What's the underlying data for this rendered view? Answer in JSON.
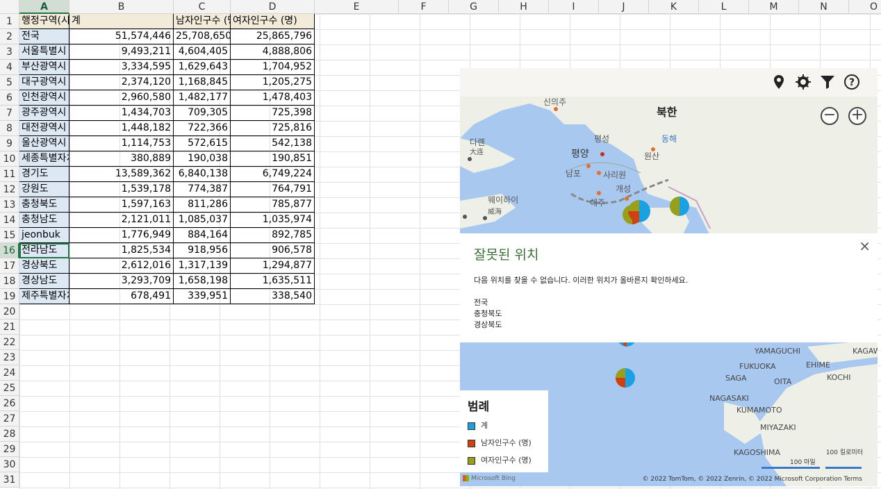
{
  "columns": [
    "A",
    "B",
    "C",
    "D",
    "E",
    "F",
    "G",
    "H",
    "I",
    "J",
    "K",
    "L",
    "M",
    "N",
    "O"
  ],
  "rows": [
    "1",
    "2",
    "3",
    "4",
    "5",
    "6",
    "7",
    "8",
    "9",
    "10",
    "11",
    "12",
    "13",
    "14",
    "15",
    "16",
    "17",
    "18",
    "19",
    "20",
    "21",
    "22",
    "23",
    "24",
    "25",
    "26",
    "27",
    "28",
    "29",
    "30",
    "31"
  ],
  "table": {
    "headers": [
      "행정구역(시군구)별",
      "계",
      "남자인구수 (명)",
      "여자인구수 (명)"
    ],
    "rows": [
      [
        "전국",
        "51,574,446",
        "25,708,650",
        "25,865,796"
      ],
      [
        "서울특별시",
        "9,493,211",
        "4,604,405",
        "4,888,806"
      ],
      [
        "부산광역시",
        "3,334,595",
        "1,629,643",
        "1,704,952"
      ],
      [
        "대구광역시",
        "2,374,120",
        "1,168,845",
        "1,205,275"
      ],
      [
        "인천광역시",
        "2,960,580",
        "1,482,177",
        "1,478,403"
      ],
      [
        "광주광역시",
        "1,434,703",
        "709,305",
        "725,398"
      ],
      [
        "대전광역시",
        "1,448,182",
        "722,366",
        "725,816"
      ],
      [
        "울산광역시",
        "1,114,753",
        "572,615",
        "542,138"
      ],
      [
        "세종특별자치시",
        "380,889",
        "190,038",
        "190,851"
      ],
      [
        "경기도",
        "13,589,362",
        "6,840,138",
        "6,749,224"
      ],
      [
        "강원도",
        "1,539,178",
        "774,387",
        "764,791"
      ],
      [
        "충청북도",
        "1,597,163",
        "811,286",
        "785,877"
      ],
      [
        "충청남도",
        "2,121,011",
        "1,085,037",
        "1,035,974"
      ],
      [
        "jeonbuk",
        "1,776,949",
        "884,164",
        "892,785"
      ],
      [
        "전라남도",
        "1,825,534",
        "918,956",
        "906,578"
      ],
      [
        "경상북도",
        "2,612,016",
        "1,317,139",
        "1,294,877"
      ],
      [
        "경상남도",
        "3,293,709",
        "1,658,198",
        "1,635,511"
      ],
      [
        "제주특별자치도",
        "678,491",
        "339,951",
        "338,540"
      ]
    ]
  },
  "map": {
    "labels": {
      "north_korea": "북한",
      "sinuiju": "신의주",
      "pyongseong": "평성",
      "pyongyang": "평양",
      "wonsan": "원산",
      "east_sea": "동해",
      "nampo": "남포",
      "sariwon": "사리원",
      "kaesong": "개성",
      "haeju": "해주",
      "dalian": "다롄",
      "dalian_cn": "大连",
      "weihai": "웨이하이",
      "weihai_cn": "威海"
    },
    "japan_labels": [
      "YAMAGUCHI",
      "KAGAWA",
      "FUKUOKA",
      "EHIME",
      "SAGA",
      "OITA",
      "KOCHI",
      "NAGASAKI",
      "KUMAMOTO",
      "MIYAZAKI",
      "KAGOSHIMA"
    ],
    "error": {
      "title": "잘못된 위치",
      "close": "×",
      "message": "다음 위치를 찾을 수 없습니다. 이러한 위치가 올바른지 확인하세요.",
      "items": [
        "전국",
        "충청북도",
        "경상북도"
      ]
    },
    "legend": {
      "title": "범례",
      "items": [
        {
          "label": "계",
          "color": "#1ba1e2"
        },
        {
          "label": "남자인구수 (명)",
          "color": "#d1400f"
        },
        {
          "label": "여자인구수 (명)",
          "color": "#98a01b"
        }
      ]
    },
    "attribution": "Microsoft Bing",
    "copyright": "© 2022 TomTom, © 2022 Zenrin, © 2022 Microsoft Corporation  Terms",
    "scale_miles": "100 마일",
    "scale_km": "100 킬로미터",
    "zoom_out": "−",
    "zoom_in": "+"
  }
}
